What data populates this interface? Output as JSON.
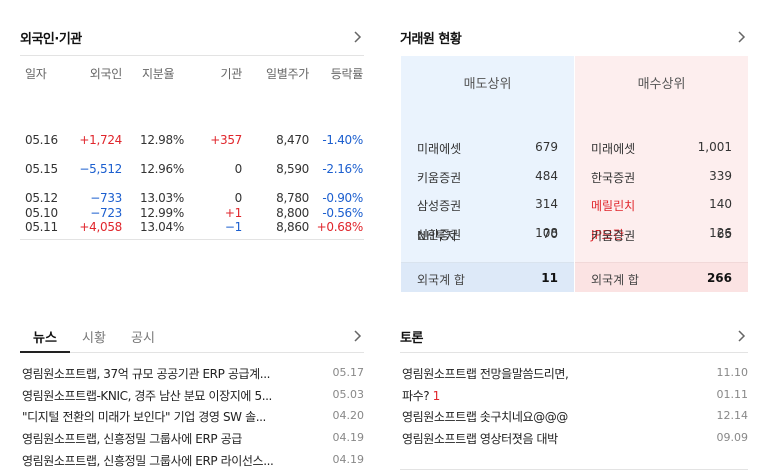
{
  "foreign": {
    "title": "외국인·기관",
    "headers": {
      "date": "일자",
      "foreign": "외국인",
      "ratio": "지분율",
      "inst": "기관",
      "price": "일별주가",
      "rate": "등락률"
    },
    "rows": [
      {
        "date": "05.16",
        "foreign": "+1,724",
        "ratio": "12.98%",
        "inst": "+357",
        "price": "8,470",
        "rate": "-1.40%"
      },
      {
        "date": "05.15",
        "foreign": "−5,512",
        "ratio": "12.96%",
        "inst": "0",
        "price": "8,590",
        "rate": "-2.16%"
      },
      {
        "date": "05.12",
        "foreign": "−733",
        "ratio": "13.03%",
        "inst": "0",
        "price": "8,780",
        "rate": "-0.90%"
      },
      {
        "date": "05.11",
        "foreign": "+4,058",
        "ratio": "13.04%",
        "inst": "−1",
        "price": "8,860",
        "rate": "+0.68%"
      },
      {
        "date": "05.10",
        "foreign": "−723",
        "ratio": "12.99%",
        "inst": "+1",
        "price": "8,800",
        "rate": "-0.56%"
      }
    ]
  },
  "broker": {
    "title": "거래원 현황",
    "sell": {
      "header": "매도상위",
      "rows": [
        {
          "name": "미래에셋",
          "value": "679"
        },
        {
          "name": "키움증권",
          "value": "484"
        },
        {
          "name": "삼성증권",
          "value": "314"
        },
        {
          "name": "신한증권",
          "value": "108"
        },
        {
          "name": "NH투자",
          "value": "70"
        }
      ],
      "sum_label": "외국계 합",
      "sum_value": "11"
    },
    "buy": {
      "header": "매수상위",
      "rows": [
        {
          "name": "미래에셋",
          "value": "1,001"
        },
        {
          "name": "한국증권",
          "value": "339"
        },
        {
          "name": "메릴린치",
          "value": "140"
        },
        {
          "name": "JP모간",
          "value": "126"
        },
        {
          "name": "키움증권",
          "value": "65"
        }
      ],
      "sum_label": "외국계 합",
      "sum_value": "266"
    }
  },
  "news": {
    "tabs": [
      "뉴스",
      "시황",
      "공시"
    ],
    "items": [
      {
        "title": "영림원소프트랩, 37억 규모 공공기관 ERP 공급계...",
        "date": "05.17"
      },
      {
        "title": "영림원소프트랩-KNIC, 경주 남산 분묘 이장지에 5...",
        "date": "05.03"
      },
      {
        "title": "\"디지털 전환의 미래가 보인다\" 기업 경영 SW 솔...",
        "date": "04.20"
      },
      {
        "title": "영림원소프트랩, 신흥정밀 그룹사에 ERP 공급",
        "date": "04.19"
      },
      {
        "title": "영림원소프트랩, 신흥정밀 그룹사에 ERP 라이선스...",
        "date": "04.19"
      }
    ]
  },
  "forum": {
    "title": "토론",
    "items": [
      {
        "title": "영림원소프트랩 전망을말씀드리면,",
        "count": "",
        "date": "11.10"
      },
      {
        "title": "파수?",
        "count": "1",
        "date": "01.11"
      },
      {
        "title": "영림원소프트랩 솟구치네요@@@",
        "count": "",
        "date": "12.14"
      },
      {
        "title": "영림원소프트랩 영상터졋음 대박",
        "count": "",
        "date": "09.09"
      }
    ]
  },
  "colors": {
    "up": "#e0262c",
    "down": "#1c5fcf",
    "sell_bg": "#eaf3fd",
    "buy_bg": "#fdeeee"
  },
  "icons": {
    "more": "chevron-right-icon"
  }
}
